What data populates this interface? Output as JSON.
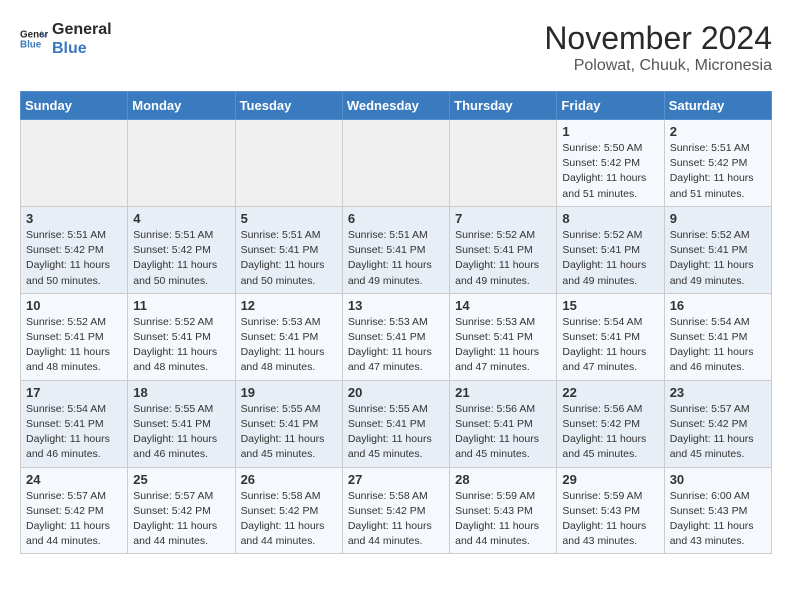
{
  "logo": {
    "line1": "General",
    "line2": "Blue"
  },
  "title": "November 2024",
  "location": "Polowat, Chuuk, Micronesia",
  "days_of_week": [
    "Sunday",
    "Monday",
    "Tuesday",
    "Wednesday",
    "Thursday",
    "Friday",
    "Saturday"
  ],
  "weeks": [
    [
      {
        "day": "",
        "info": ""
      },
      {
        "day": "",
        "info": ""
      },
      {
        "day": "",
        "info": ""
      },
      {
        "day": "",
        "info": ""
      },
      {
        "day": "",
        "info": ""
      },
      {
        "day": "1",
        "info": "Sunrise: 5:50 AM\nSunset: 5:42 PM\nDaylight: 11 hours\nand 51 minutes."
      },
      {
        "day": "2",
        "info": "Sunrise: 5:51 AM\nSunset: 5:42 PM\nDaylight: 11 hours\nand 51 minutes."
      }
    ],
    [
      {
        "day": "3",
        "info": "Sunrise: 5:51 AM\nSunset: 5:42 PM\nDaylight: 11 hours\nand 50 minutes."
      },
      {
        "day": "4",
        "info": "Sunrise: 5:51 AM\nSunset: 5:42 PM\nDaylight: 11 hours\nand 50 minutes."
      },
      {
        "day": "5",
        "info": "Sunrise: 5:51 AM\nSunset: 5:41 PM\nDaylight: 11 hours\nand 50 minutes."
      },
      {
        "day": "6",
        "info": "Sunrise: 5:51 AM\nSunset: 5:41 PM\nDaylight: 11 hours\nand 49 minutes."
      },
      {
        "day": "7",
        "info": "Sunrise: 5:52 AM\nSunset: 5:41 PM\nDaylight: 11 hours\nand 49 minutes."
      },
      {
        "day": "8",
        "info": "Sunrise: 5:52 AM\nSunset: 5:41 PM\nDaylight: 11 hours\nand 49 minutes."
      },
      {
        "day": "9",
        "info": "Sunrise: 5:52 AM\nSunset: 5:41 PM\nDaylight: 11 hours\nand 49 minutes."
      }
    ],
    [
      {
        "day": "10",
        "info": "Sunrise: 5:52 AM\nSunset: 5:41 PM\nDaylight: 11 hours\nand 48 minutes."
      },
      {
        "day": "11",
        "info": "Sunrise: 5:52 AM\nSunset: 5:41 PM\nDaylight: 11 hours\nand 48 minutes."
      },
      {
        "day": "12",
        "info": "Sunrise: 5:53 AM\nSunset: 5:41 PM\nDaylight: 11 hours\nand 48 minutes."
      },
      {
        "day": "13",
        "info": "Sunrise: 5:53 AM\nSunset: 5:41 PM\nDaylight: 11 hours\nand 47 minutes."
      },
      {
        "day": "14",
        "info": "Sunrise: 5:53 AM\nSunset: 5:41 PM\nDaylight: 11 hours\nand 47 minutes."
      },
      {
        "day": "15",
        "info": "Sunrise: 5:54 AM\nSunset: 5:41 PM\nDaylight: 11 hours\nand 47 minutes."
      },
      {
        "day": "16",
        "info": "Sunrise: 5:54 AM\nSunset: 5:41 PM\nDaylight: 11 hours\nand 46 minutes."
      }
    ],
    [
      {
        "day": "17",
        "info": "Sunrise: 5:54 AM\nSunset: 5:41 PM\nDaylight: 11 hours\nand 46 minutes."
      },
      {
        "day": "18",
        "info": "Sunrise: 5:55 AM\nSunset: 5:41 PM\nDaylight: 11 hours\nand 46 minutes."
      },
      {
        "day": "19",
        "info": "Sunrise: 5:55 AM\nSunset: 5:41 PM\nDaylight: 11 hours\nand 45 minutes."
      },
      {
        "day": "20",
        "info": "Sunrise: 5:55 AM\nSunset: 5:41 PM\nDaylight: 11 hours\nand 45 minutes."
      },
      {
        "day": "21",
        "info": "Sunrise: 5:56 AM\nSunset: 5:41 PM\nDaylight: 11 hours\nand 45 minutes."
      },
      {
        "day": "22",
        "info": "Sunrise: 5:56 AM\nSunset: 5:42 PM\nDaylight: 11 hours\nand 45 minutes."
      },
      {
        "day": "23",
        "info": "Sunrise: 5:57 AM\nSunset: 5:42 PM\nDaylight: 11 hours\nand 45 minutes."
      }
    ],
    [
      {
        "day": "24",
        "info": "Sunrise: 5:57 AM\nSunset: 5:42 PM\nDaylight: 11 hours\nand 44 minutes."
      },
      {
        "day": "25",
        "info": "Sunrise: 5:57 AM\nSunset: 5:42 PM\nDaylight: 11 hours\nand 44 minutes."
      },
      {
        "day": "26",
        "info": "Sunrise: 5:58 AM\nSunset: 5:42 PM\nDaylight: 11 hours\nand 44 minutes."
      },
      {
        "day": "27",
        "info": "Sunrise: 5:58 AM\nSunset: 5:42 PM\nDaylight: 11 hours\nand 44 minutes."
      },
      {
        "day": "28",
        "info": "Sunrise: 5:59 AM\nSunset: 5:43 PM\nDaylight: 11 hours\nand 44 minutes."
      },
      {
        "day": "29",
        "info": "Sunrise: 5:59 AM\nSunset: 5:43 PM\nDaylight: 11 hours\nand 43 minutes."
      },
      {
        "day": "30",
        "info": "Sunrise: 6:00 AM\nSunset: 5:43 PM\nDaylight: 11 hours\nand 43 minutes."
      }
    ]
  ]
}
